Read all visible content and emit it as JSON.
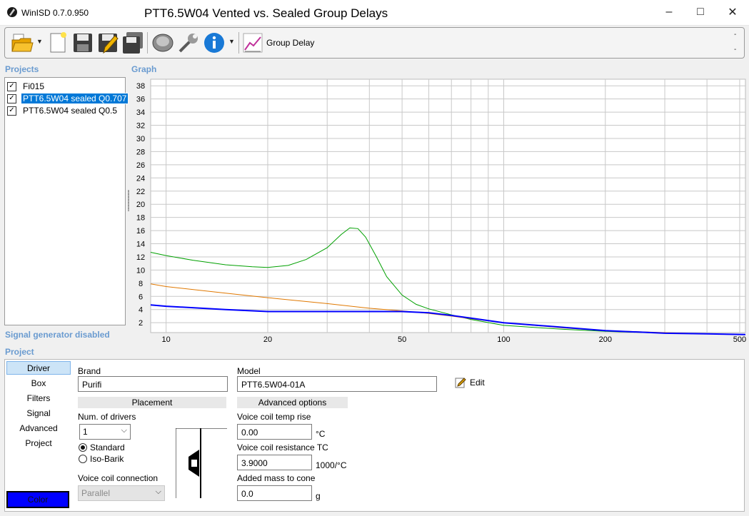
{
  "app": {
    "name": "WinISD 0.7.0.950",
    "window_title": "PTT6.5W04 Vented vs. Sealed Group Delays"
  },
  "titlebar_buttons": {
    "minimize": "–",
    "maximize": "□",
    "close": "✕"
  },
  "toolbar": {
    "graph_type_label": "Group Delay",
    "dash_top": "-",
    "dash_bottom": "-",
    "icons": [
      "open-folder-icon",
      "new-document-icon",
      "save-icon",
      "edit-save-icon",
      "save-all-icon",
      "driver-editor-icon",
      "tools-icon",
      "info-icon",
      "graph-icon"
    ]
  },
  "projects": {
    "title": "Projects",
    "items": [
      {
        "label": "Fi015",
        "checked": true,
        "selected": false
      },
      {
        "label": "PTT6.5W04 sealed Q0.707",
        "checked": true,
        "selected": true
      },
      {
        "label": "PTT6.5W04 sealed Q0.5",
        "checked": true,
        "selected": false
      }
    ]
  },
  "graph": {
    "title": "Graph"
  },
  "signal_generator": "Signal generator disabled",
  "project": {
    "title": "Project",
    "nav": [
      "Driver",
      "Box",
      "Filters",
      "Signal",
      "Advanced",
      "Project"
    ],
    "active_nav": "Driver",
    "color_button": "Color",
    "brand": {
      "label": "Brand",
      "value": "Purifi"
    },
    "model": {
      "label": "Model",
      "value": "PTT6.5W04-01A"
    },
    "edit_label": "Edit",
    "placement": {
      "header": "Placement",
      "num_drivers_label": "Num. of drivers",
      "num_drivers_value": "1",
      "radio_standard": "Standard",
      "radio_isobarik": "Iso-Barik",
      "voice_coil_connection_label": "Voice coil connection",
      "voice_coil_connection_value": "Parallel"
    },
    "advanced": {
      "header": "Advanced options",
      "temp_rise_label": "Voice coil temp rise",
      "temp_rise_value": "0.00",
      "temp_rise_unit": "°C",
      "resistance_tc_label": "Voice coil resistance TC",
      "resistance_tc_value": "3.9000",
      "resistance_tc_unit": "1000/°C",
      "added_mass_label": "Added mass to cone",
      "added_mass_value": "0.0",
      "added_mass_unit": "g"
    }
  },
  "chart_data": {
    "type": "line",
    "x_scale": "log",
    "xlim": [
      9,
      520
    ],
    "ylim": [
      0.5,
      39
    ],
    "x_ticks": [
      10,
      20,
      50,
      100,
      200,
      500
    ],
    "y_ticks": [
      2,
      4,
      6,
      8,
      10,
      12,
      14,
      16,
      18,
      20,
      22,
      24,
      26,
      28,
      30,
      32,
      34,
      36,
      38
    ],
    "grid": true,
    "series": [
      {
        "color": "#00a000",
        "x": [
          9,
          10,
          12,
          15,
          18,
          20,
          23,
          26,
          30,
          33,
          35,
          37,
          39,
          42,
          45,
          50,
          55,
          60,
          70,
          80,
          100,
          150,
          200,
          300,
          400,
          520
        ],
        "y": [
          12.7,
          12.2,
          11.5,
          10.8,
          10.5,
          10.4,
          10.7,
          11.6,
          13.4,
          15.4,
          16.4,
          16.3,
          15.0,
          12.0,
          9.0,
          6.2,
          4.8,
          4.1,
          3.2,
          2.5,
          1.6,
          1.0,
          0.7,
          0.4,
          0.3,
          0.2
        ]
      },
      {
        "color": "#e07800",
        "x": [
          9,
          10,
          15,
          20,
          30,
          40,
          50,
          60,
          70,
          80,
          100,
          150,
          200,
          300,
          400,
          520
        ],
        "y": [
          7.9,
          7.5,
          6.5,
          5.8,
          4.9,
          4.2,
          3.8,
          3.4,
          3.0,
          2.6,
          2.0,
          1.2,
          0.8,
          0.5,
          0.3,
          0.2
        ]
      },
      {
        "color": "#0000ff",
        "x": [
          9,
          10,
          15,
          20,
          30,
          40,
          50,
          60,
          70,
          80,
          100,
          150,
          200,
          300,
          400,
          520
        ],
        "y": [
          4.7,
          4.5,
          4.0,
          3.7,
          3.7,
          3.7,
          3.7,
          3.5,
          3.1,
          2.7,
          2.0,
          1.3,
          0.8,
          0.4,
          0.3,
          0.2
        ]
      }
    ]
  }
}
